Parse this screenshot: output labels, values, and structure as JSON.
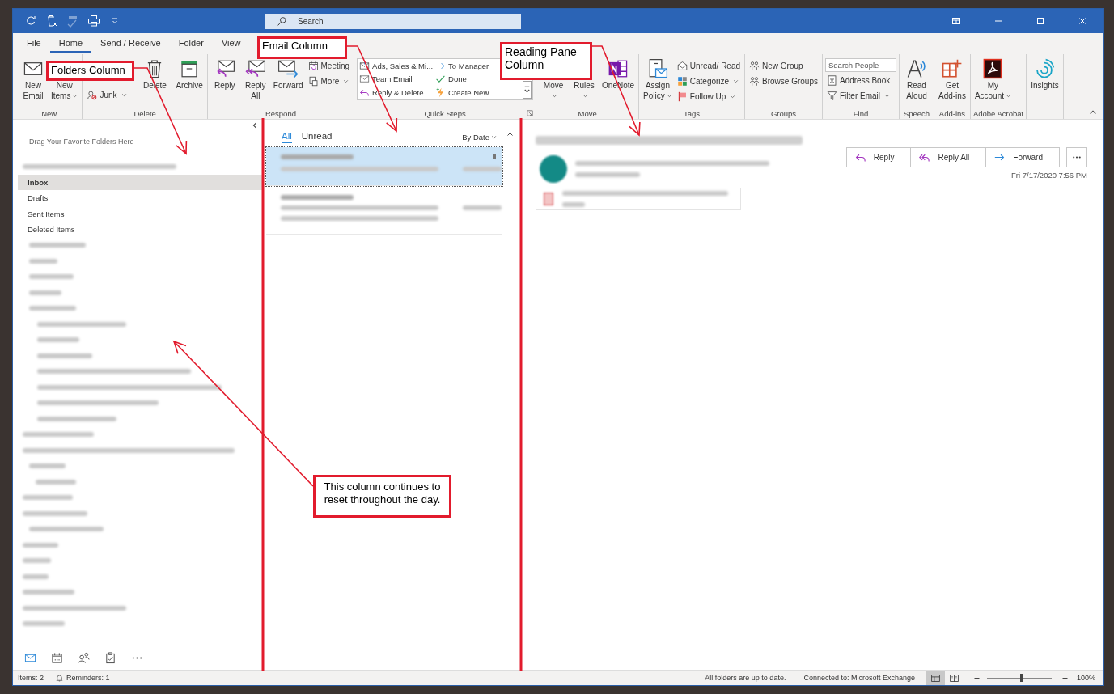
{
  "title_bar": {
    "quick_access": [
      {
        "disabled": false
      },
      {
        "disabled": false
      },
      {
        "disabled": true
      },
      {
        "disabled": false
      },
      {
        "disabled": false
      }
    ],
    "search": {
      "placeholder": "Search"
    }
  },
  "ribbon_tabs": [
    {
      "label": "File",
      "selected": false
    },
    {
      "label": "Home",
      "selected": true
    },
    {
      "label": "Send / Receive",
      "selected": false
    },
    {
      "label": "Folder",
      "selected": false
    },
    {
      "label": "View",
      "selected": false
    }
  ],
  "ribbon_groups": [
    {
      "label": "New",
      "items": [
        {
          "kind": "large",
          "label": "New Email",
          "menu": false
        },
        {
          "kind": "large",
          "label": "New Items",
          "menu": true
        }
      ]
    },
    {
      "label": "Delete",
      "items": [
        {
          "kind": "small",
          "label": "Junk",
          "menu": true
        },
        {
          "kind": "large",
          "label": "Delete",
          "menu": false
        },
        {
          "kind": "large",
          "label": "Archive",
          "menu": false
        }
      ]
    },
    {
      "label": "Respond",
      "items": [
        {
          "kind": "large",
          "label": "Reply",
          "menu": false
        },
        {
          "kind": "large",
          "label": "Reply All",
          "menu": false
        },
        {
          "kind": "large",
          "label": "Forward",
          "menu": false
        },
        {
          "kind": "small",
          "label": "Meeting",
          "menu": false
        },
        {
          "kind": "small",
          "label": "More",
          "menu": true
        }
      ]
    },
    {
      "label": "Quick Steps",
      "items": [
        {
          "kind": "gallery",
          "entries": [
            "Ads, Sales & Mi...",
            "To Manager",
            "Team Email",
            "Done",
            "Reply & Delete",
            "Create New"
          ]
        }
      ]
    },
    {
      "label": "Move",
      "items": [
        {
          "kind": "large",
          "label": "Move",
          "menu": true
        },
        {
          "kind": "large",
          "label": "Rules",
          "menu": true
        },
        {
          "kind": "large",
          "label": "OneNote",
          "menu": false
        }
      ]
    },
    {
      "label": "Tags",
      "items": [
        {
          "kind": "large",
          "label": "Assign Policy",
          "menu": true
        },
        {
          "kind": "small",
          "label": "Unread/ Read",
          "menu": false
        },
        {
          "kind": "small",
          "label": "Categorize",
          "menu": true
        },
        {
          "kind": "small",
          "label": "Follow Up",
          "menu": true
        }
      ]
    },
    {
      "label": "Groups",
      "items": [
        {
          "kind": "small",
          "label": "New Group",
          "menu": false
        },
        {
          "kind": "small",
          "label": "Browse Groups",
          "menu": false
        }
      ]
    },
    {
      "label": "Find",
      "items": [
        {
          "kind": "search",
          "placeholder": "Search People"
        },
        {
          "kind": "small",
          "label": "Address Book",
          "menu": false
        },
        {
          "kind": "small",
          "label": "Filter Email",
          "menu": true
        }
      ]
    },
    {
      "label": "Speech",
      "items": [
        {
          "kind": "large",
          "label": "Read Aloud",
          "menu": false
        }
      ]
    },
    {
      "label": "Add-ins",
      "items": [
        {
          "kind": "large",
          "label": "Get Add-ins",
          "menu": false
        }
      ]
    },
    {
      "label": "Adobe Acrobat",
      "items": [
        {
          "kind": "large",
          "label": "My Account",
          "menu": true
        }
      ]
    },
    {
      "items": [
        {
          "kind": "large",
          "label": "Insights",
          "menu": false
        }
      ]
    }
  ],
  "folder_pane": {
    "favorites_hint": "Drag Your Favorite Folders Here",
    "folders": [
      {
        "kind": "blurred"
      },
      {
        "kind": "folder",
        "label": "Inbox",
        "selected": true
      },
      {
        "kind": "folder",
        "label": "Drafts",
        "selected": false
      },
      {
        "kind": "folder",
        "label": "Sent Items",
        "selected": false
      },
      {
        "kind": "folder",
        "label": "Deleted Items",
        "selected": false
      },
      {
        "kind": "blurred"
      },
      {
        "kind": "blurred"
      },
      {
        "kind": "blurred"
      },
      {
        "kind": "blurred"
      },
      {
        "kind": "blurred"
      },
      {
        "kind": "blurred"
      },
      {
        "kind": "blurred"
      },
      {
        "kind": "blurred"
      },
      {
        "kind": "blurred"
      },
      {
        "kind": "blurred"
      },
      {
        "kind": "blurred"
      },
      {
        "kind": "blurred"
      },
      {
        "kind": "blurred"
      },
      {
        "kind": "blurred"
      },
      {
        "kind": "blurred"
      },
      {
        "kind": "blurred"
      },
      {
        "kind": "blurred"
      },
      {
        "kind": "blurred"
      },
      {
        "kind": "blurred"
      },
      {
        "kind": "blurred"
      },
      {
        "kind": "blurred"
      },
      {
        "kind": "blurred"
      },
      {
        "kind": "blurred"
      },
      {
        "kind": "blurred"
      },
      {
        "kind": "blurred"
      }
    ],
    "nav": [
      {
        "selected": true
      },
      {
        "selected": false
      },
      {
        "selected": false
      },
      {
        "selected": false
      },
      {
        "selected": false
      }
    ]
  },
  "message_list": {
    "filters": [
      {
        "label": "All",
        "selected": true
      },
      {
        "label": "Unread",
        "selected": false
      }
    ],
    "sort": "By Date",
    "messages": [
      {
        "selected": true
      },
      {
        "selected": false
      }
    ]
  },
  "reading_pane": {
    "actions": [
      "Reply",
      "Reply All",
      "Forward"
    ],
    "received": "Fri 7/17/2020 7:56 PM"
  },
  "status_bar": {
    "items": "Items: 2",
    "reminders": "Reminders: 1",
    "sync": "All folders are up to date.",
    "connection": "Connected to: Microsoft Exchange",
    "views": [
      {
        "selected": true
      },
      {
        "selected": false
      }
    ],
    "zoom_slider": {
      "level": 0.52
    },
    "zoom": "100%"
  },
  "annotations": [
    {
      "text": "Folders Column"
    },
    {
      "text": "Email Column"
    },
    {
      "text": "Reading Pane Column"
    },
    {
      "text": "This column continues to reset throughout the day."
    }
  ]
}
